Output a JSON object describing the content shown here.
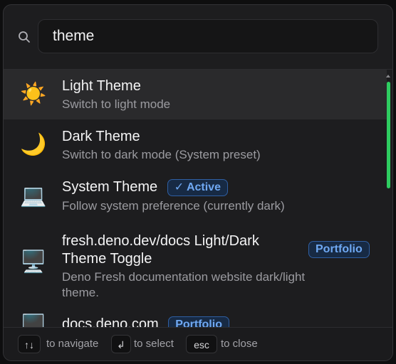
{
  "search": {
    "query": "theme"
  },
  "results": [
    {
      "icon": "sun-icon",
      "emoji": "☀️",
      "title": "Light Theme",
      "subtitle": "Switch to light mode",
      "badge": ""
    },
    {
      "icon": "crescent-moon-icon",
      "emoji": "🌙",
      "title": "Dark Theme",
      "subtitle": "Switch to dark mode (System preset)",
      "badge": ""
    },
    {
      "icon": "laptop-icon",
      "emoji": "💻",
      "title": "System Theme",
      "subtitle": "Follow system preference (currently dark)",
      "badge": "✓ Active"
    },
    {
      "icon": "desktop-computer-icon",
      "emoji": "🖥️",
      "title_line1": "fresh.deno.dev/docs Light/Dark",
      "title_line2": "Theme Toggle",
      "subtitle_line1": "Deno Fresh documentation website dark/light",
      "subtitle_line2": "theme.",
      "badge": "Portfolio"
    },
    {
      "icon": "desktop-computer-icon",
      "emoji": "🖥️",
      "title": "docs.deno.com",
      "badge": "Portfolio"
    }
  ],
  "footer": {
    "navigate_key": "↑↓",
    "navigate_label": "to navigate",
    "select_key": "↲",
    "select_label": "to select",
    "close_key": "esc",
    "close_label": "to close"
  },
  "colors": {
    "accent_badge": "#6fa8f2",
    "scroll_thumb": "#2ecc60"
  }
}
